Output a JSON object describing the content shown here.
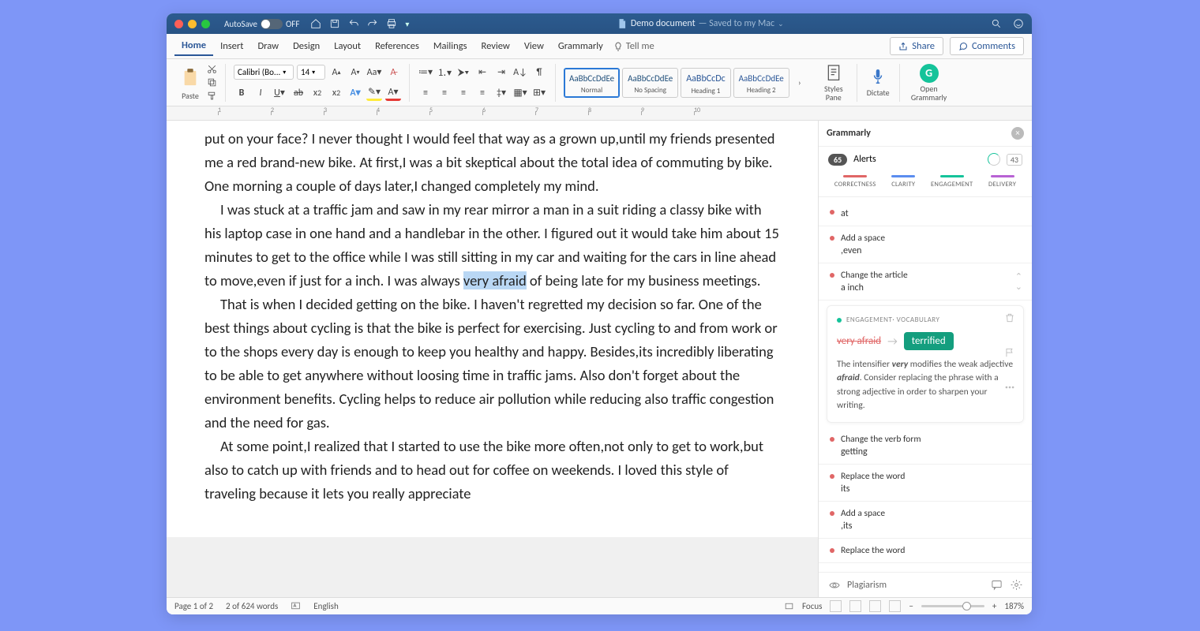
{
  "titlebar": {
    "autosave_label": "AutoSave",
    "autosave_state": "OFF",
    "doc_name": "Demo document",
    "saved_hint": "— Saved to my Mac"
  },
  "menu": {
    "items": [
      "Home",
      "Insert",
      "Draw",
      "Design",
      "Layout",
      "References",
      "Mailings",
      "Review",
      "View",
      "Grammarly"
    ],
    "tellme": "Tell me",
    "share": "Share",
    "comments": "Comments"
  },
  "ribbon": {
    "paste": "Paste",
    "font_name": "Calibri (Bo...",
    "font_size": "14",
    "styles": [
      {
        "preview": "AaBbCcDdEe",
        "label": "Normal"
      },
      {
        "preview": "AaBbCcDdEe",
        "label": "No Spacing"
      },
      {
        "preview": "AaBbCcDc",
        "label": "Heading 1"
      },
      {
        "preview": "AaBbCcDdEe",
        "label": "Heading 2"
      }
    ],
    "styles_pane": "Styles Pane",
    "dictate": "Dictate",
    "open_grammarly": "Open Grammarly"
  },
  "document": {
    "p1": "put on your face? I never thought I would feel that way as a grown up,until my friends presented me a red brand-new bike. At first,I was a bit skeptical about the total idea of commuting by bike. One morning a couple of days later,I changed completely my mind.",
    "p2a": "I was stuck at a traffic jam and saw in my rear mirror a man in a suit riding a classy bike with his laptop case in one hand and a handlebar in the other. I figured out it would take him about 15 minutes to get to the office while I was still sitting in my car and waiting for the cars in line ahead to move,even if just for a inch. I was always ",
    "p2_hl": "very afraid",
    "p2b": " of being late for my business meetings.",
    "p3": "That is when I decided getting on the bike. I haven't regretted my decision so far. One of the best things about cycling is that the bike is perfect for exercising. Just cycling to and from work or to the shops every day is enough to keep you healthy and happy. Besides,its incredibly liberating to be able to get anywhere without loosing time in traffic jams. Also don't forget about the environment benefits. Cycling helps to reduce air pollution while reducing also traffic congestion and the need for gas.",
    "p4": "At some point,I realized that I started to use the bike more often,not only to get to work,but also to catch up with friends and to head out for coffee on weekends. I loved this style of traveling because it lets you really appreciate"
  },
  "grammarly": {
    "title": "Grammarly",
    "alert_count": "65",
    "alerts_label": "Alerts",
    "score": "43",
    "tabs": [
      "CORRECTNESS",
      "CLARITY",
      "ENGAGEMENT",
      "DELIVERY"
    ],
    "tab_colors": [
      "#e06666",
      "#5b8def",
      "#15c39a",
      "#b862d4"
    ],
    "cards": [
      {
        "dot": "#e06666",
        "title": "",
        "sub": "at"
      },
      {
        "dot": "#e06666",
        "title": "Add a space",
        "sub": ",even"
      },
      {
        "dot": "#e06666",
        "title": "Change the article",
        "sub": "a inch"
      }
    ],
    "expanded": {
      "tag": "ENGAGEMENT· VOCABULARY",
      "strike": "very afraid",
      "suggestion": "terrified",
      "desc_pre": "The intensifier ",
      "desc_em1": "very",
      "desc_mid": " modifies the weak adjective ",
      "desc_em2": "afraid",
      "desc_post": ". Consider replacing the phrase with a strong adjective in order to sharpen your writing."
    },
    "cards2": [
      {
        "dot": "#e06666",
        "title": "Change the verb form",
        "sub": "getting"
      },
      {
        "dot": "#e06666",
        "title": "Replace the word",
        "sub": "its"
      },
      {
        "dot": "#e06666",
        "title": "Add a space",
        "sub": ",its"
      },
      {
        "dot": "#e06666",
        "title": "Replace the word",
        "sub": ""
      }
    ],
    "plagiarism": "Plagiarism"
  },
  "status": {
    "page": "Page 1 of 2",
    "words": "2 of 624 words",
    "lang": "English",
    "focus": "Focus",
    "zoom": "187%"
  },
  "ruler_nums": [
    "1",
    "2",
    "3",
    "4",
    "5",
    "6",
    "7",
    "8",
    "9",
    "10"
  ]
}
